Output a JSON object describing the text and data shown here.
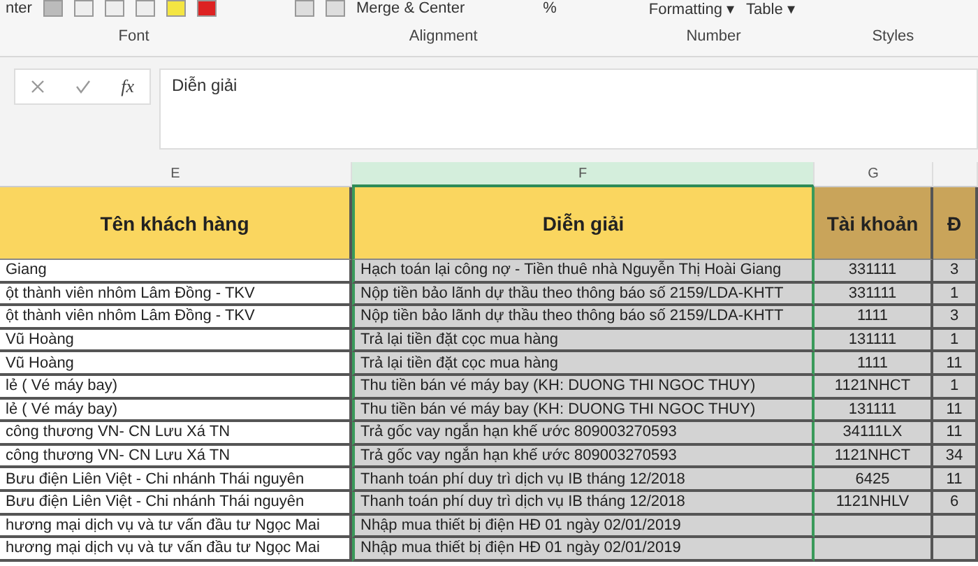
{
  "ribbon": {
    "left_fragment": "nter",
    "merge_button": "Merge & Center",
    "percent": "%",
    "style_buttons": [
      "Formatting ▾",
      "Table ▾"
    ],
    "groups": [
      {
        "label": "Font"
      },
      {
        "label": "Alignment"
      },
      {
        "label": "Number"
      },
      {
        "label": "Styles"
      }
    ]
  },
  "formula_bar": {
    "function_label": "fx",
    "value": "Diễn giải"
  },
  "columns": [
    {
      "letter": "E",
      "selected": false,
      "shaded": false,
      "header": "Tên khách hàng",
      "color": "#fad65f"
    },
    {
      "letter": "F",
      "selected": true,
      "shaded": true,
      "header": "Diễn giải",
      "color": "#fad65f"
    },
    {
      "letter": "G",
      "selected": false,
      "shaded": true,
      "header": "Tài khoản",
      "color": "#c9a45a"
    },
    {
      "shaded": true,
      "header": "Đ",
      "color": "#c9a45a"
    }
  ],
  "rows": [
    {
      "cells": [
        "Giang",
        "Hạch toán lại công nợ - Tiền thuê nhà Nguyễn Thị Hoài Giang",
        "331111",
        "3"
      ]
    },
    {
      "cells": [
        "ột thành viên nhôm Lâm Đồng - TKV",
        "Nộp tiền bảo lãnh dự thầu theo thông báo số 2159/LDA-KHTT",
        "331111",
        "1"
      ]
    },
    {
      "cells": [
        "ột thành viên nhôm Lâm Đồng - TKV",
        "Nộp tiền bảo lãnh dự thầu theo thông báo số 2159/LDA-KHTT",
        "1111",
        "3"
      ]
    },
    {
      "cells": [
        "Vũ Hoàng",
        "Trả lại tiền đặt cọc mua hàng",
        "131111",
        "1"
      ]
    },
    {
      "cells": [
        "Vũ Hoàng",
        "Trả lại tiền đặt cọc mua hàng",
        "1111",
        "11"
      ]
    },
    {
      "cells": [
        "lẻ ( Vé máy bay)",
        "Thu tiền bán vé máy bay (KH: DUONG THI NGOC THUY)",
        "1121NHCT",
        "1"
      ]
    },
    {
      "cells": [
        "lẻ ( Vé máy bay)",
        "Thu tiền bán vé máy bay (KH: DUONG THI NGOC THUY)",
        "131111",
        "11"
      ]
    },
    {
      "cells": [
        "công thương VN- CN  Lưu Xá TN",
        "Trả gốc vay ngắn hạn khế ước 809003270593",
        "34111LX",
        "11"
      ]
    },
    {
      "cells": [
        "công thương VN- CN  Lưu Xá TN",
        "Trả gốc vay ngắn hạn khế ước 809003270593",
        "1121NHCT",
        "34"
      ]
    },
    {
      "cells": [
        "Bưu điện Liên Việt - Chi nhánh Thái nguyên",
        "Thanh toán phí duy trì dịch vụ IB tháng 12/2018",
        "6425",
        "11"
      ]
    },
    {
      "cells": [
        "Bưu điện Liên Việt - Chi nhánh Thái nguyên",
        "Thanh toán phí duy trì dịch vụ IB tháng 12/2018",
        "1121NHLV",
        "6"
      ]
    },
    {
      "cells": [
        "hương mại dịch vụ và tư vấn đầu tư Ngọc Mai",
        "Nhập mua thiết bị điện HĐ 01 ngày 02/01/2019"
      ]
    },
    {
      "cells": [
        "hương mại dịch vụ và tư vấn đầu tư Ngọc Mai",
        "Nhập mua thiết bị điện HĐ 01 ngày 02/01/2019"
      ]
    }
  ]
}
